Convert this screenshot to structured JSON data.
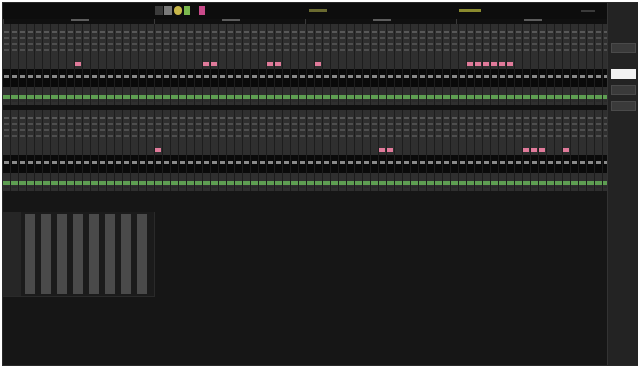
{
  "sections": [
    "",
    "",
    "",
    ""
  ],
  "sidebar": {
    "buttons": [
      "",
      "",
      "",
      ""
    ]
  },
  "colors": {
    "background": "#161616",
    "strip": "#2f2f2f",
    "name_bar": "#5e9e52",
    "mute_pink": "#e07a9a",
    "selected": "#f2f2f2",
    "accent_yellow": "#c9b84a",
    "accent_green": "#7ab84e",
    "accent_purple": "#8a4fb3",
    "accent_orange": "#d9852e",
    "accent_blue": "#5a7fd1"
  },
  "icons": [
    "transport-play-icon",
    "transport-record-icon",
    "meter-icon"
  ]
}
